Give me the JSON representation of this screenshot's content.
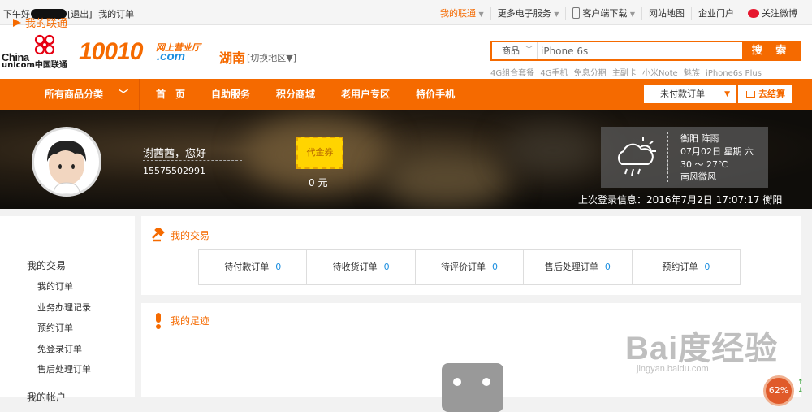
{
  "topbar": {
    "greeting_pre": "下午好",
    "greeting_post": "[退出]",
    "my_orders": "我的订单",
    "links": {
      "my_unicom": "我的联通",
      "more_services": "更多电子服务",
      "client_download": "客户端下载",
      "site_map": "网站地图",
      "enterprise_portal": "企业门户",
      "follow_weibo": "关注微博"
    }
  },
  "header": {
    "logo_china": "China",
    "logo_unicom": "unicom中国联通",
    "logo_number": "10010",
    "logo_tagline": "网上营业厅",
    "logo_domain": ".com",
    "region": "湖南",
    "region_switch": "[切换地区▼]"
  },
  "search": {
    "category": "商品",
    "value": "iPhone 6s",
    "button": "搜 索",
    "hot_keywords": [
      "4G组合套餐",
      "4G手机",
      "免息分期",
      "主副卡",
      "小米Note",
      "魅族",
      "iPhone6s Plus"
    ]
  },
  "nav": {
    "all_categories": "所有商品分类",
    "items": [
      "首　页",
      "自助服务",
      "积分商城",
      "老用户专区",
      "特价手机"
    ],
    "unpaid_orders": "未付款订单",
    "checkout": "去结算"
  },
  "banner": {
    "user_greeting": "谢茜茜，您好",
    "phone": "15575502991",
    "coupon_label": "代金券",
    "coupon_value": "0 元",
    "weather": {
      "city_condition": "衡阳   阵雨",
      "date": "07月02日   星期 六",
      "temperature": "30 ～ 27℃",
      "wind": "南风微风"
    },
    "last_login": "上次登录信息：2016年7月2日 17:07:17  衡阳"
  },
  "sidebar": {
    "heading": "我的联通",
    "section": "我的交易",
    "items": [
      "我的订单",
      "业务办理记录",
      "预约订单",
      "免登录订单",
      "售后处理订单"
    ],
    "next_section": "我的帐户"
  },
  "transactions": {
    "title": "我的交易",
    "orders": [
      {
        "label": "待付款订单",
        "count": "0"
      },
      {
        "label": "待收货订单",
        "count": "0"
      },
      {
        "label": "待评价订单",
        "count": "0"
      },
      {
        "label": "售后处理订单",
        "count": "0"
      },
      {
        "label": "预约订单",
        "count": "0"
      }
    ]
  },
  "footprints": {
    "title": "我的足迹"
  },
  "watermark": {
    "main": "Bai度经验",
    "sub": "jingyan.baidu.com"
  },
  "gauge": {
    "value": "62%"
  },
  "colors": {
    "brand_orange": "#f56a00",
    "link_blue": "#1c8fe0"
  }
}
